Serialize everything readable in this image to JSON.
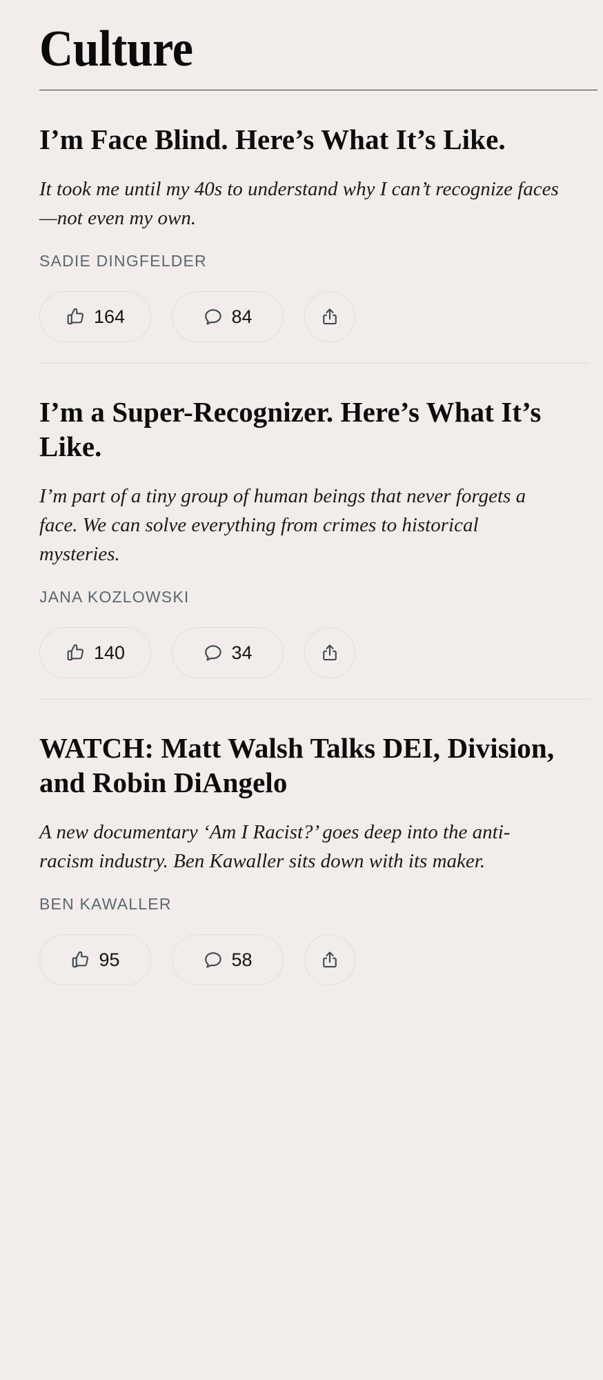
{
  "masthead": {
    "title": "Culture"
  },
  "theme": {
    "background": "#F2EDEA",
    "text": "#0D0D0D",
    "byline": "#5C6670",
    "rule": "#3A3633",
    "divider": "#E0D9D5",
    "button_border": "#E3DCD8",
    "icon_stroke": "#414A52"
  },
  "icons": {
    "like": "thumbs-up-icon",
    "comment": "speech-bubble-icon",
    "share": "share-icon"
  },
  "articles": [
    {
      "headline": "I’m Face Blind. Here’s What It’s Like.",
      "deck": "It took me until my 40s to understand why I can’t recognize faces—not even my own.",
      "byline": "Sadie Dingfelder",
      "likes": "164",
      "comments": "84"
    },
    {
      "headline": "I’m a Super-Recognizer. Here’s What It’s Like.",
      "deck": "I’m part of a tiny group of human beings that never forgets a face. We can solve everything from crimes to historical mysteries.",
      "byline": "Jana Kozlowski",
      "likes": "140",
      "comments": "34"
    },
    {
      "headline": "WATCH: Matt Walsh Talks DEI, Division, and Robin DiAngelo",
      "deck": "A new documentary ‘Am I Racist?’ goes deep into the anti-racism industry. Ben Kawaller sits down with its maker.",
      "byline": "Ben Kawaller",
      "likes": "95",
      "comments": "58"
    }
  ]
}
